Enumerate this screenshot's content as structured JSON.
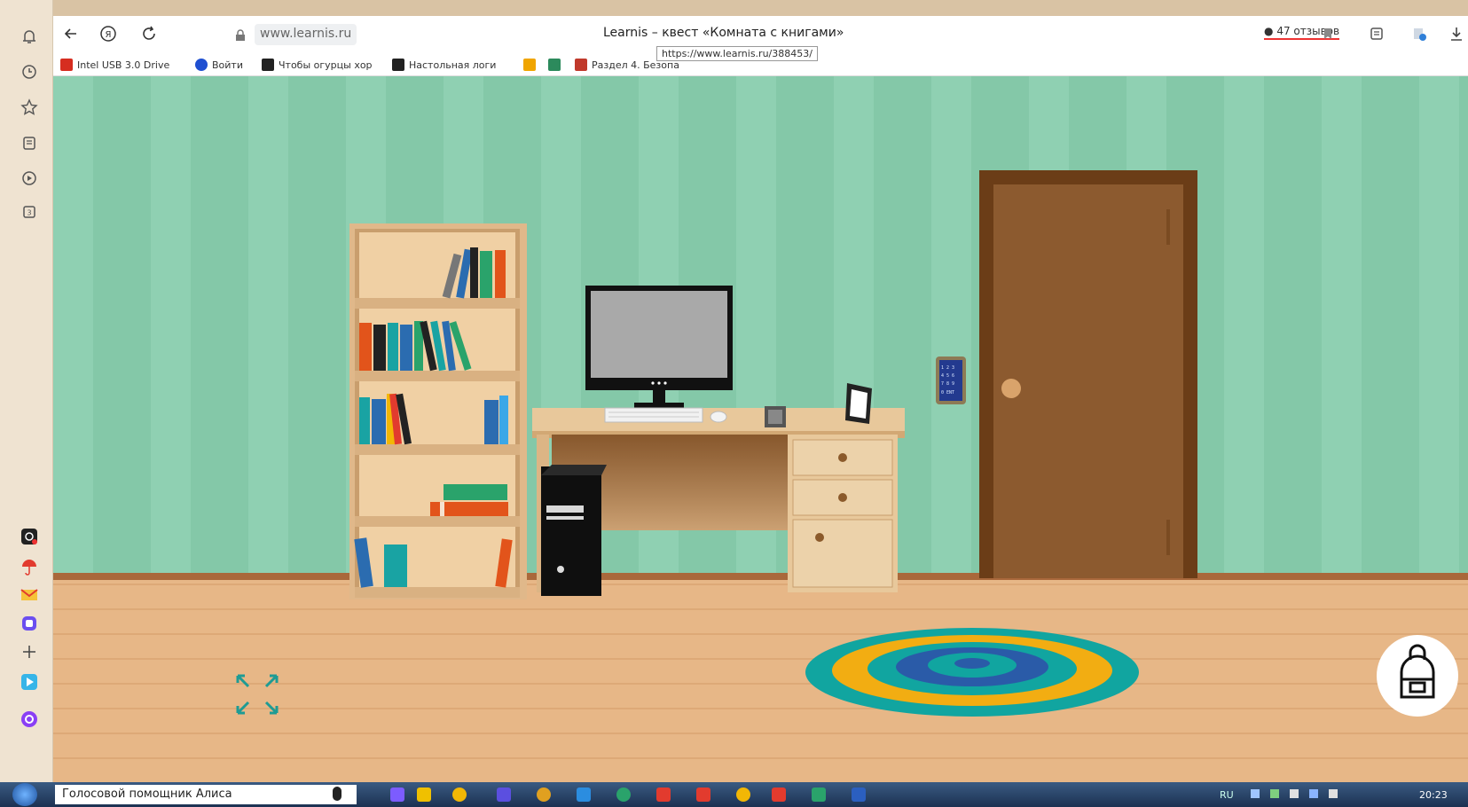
{
  "browser": {
    "address": "www.learnis.ru",
    "title": "Learnis – квест «Комната с книгами»",
    "url_tooltip": "https://www.learnis.ru/388453/",
    "reviews": "47 отзывов"
  },
  "bookmarks": [
    {
      "label": "Intel USB 3.0 Drive",
      "color": "#d62d20"
    },
    {
      "label": "Войти",
      "color": "#1f4fd1"
    },
    {
      "label": "Чтобы огурцы хор",
      "color": "#222222"
    },
    {
      "label": "Настольная логи",
      "color": "#222222"
    },
    {
      "label": "",
      "color": "#f0a500"
    },
    {
      "label": "",
      "color": "#2c8a5c"
    },
    {
      "label": "Раздел 4. Безопа",
      "color": "#c0392b"
    }
  ],
  "keypad": {
    "digits": "1 2 3 4 5 6 7 8 9 0 ENT"
  },
  "taskbar": {
    "assistant": "Голосовой помощник Алиса",
    "lang": "RU",
    "clock": "20:23"
  },
  "colors": {
    "wall": "#8fd0b2",
    "floor": "#e4b283",
    "door": "#7f4d26"
  }
}
